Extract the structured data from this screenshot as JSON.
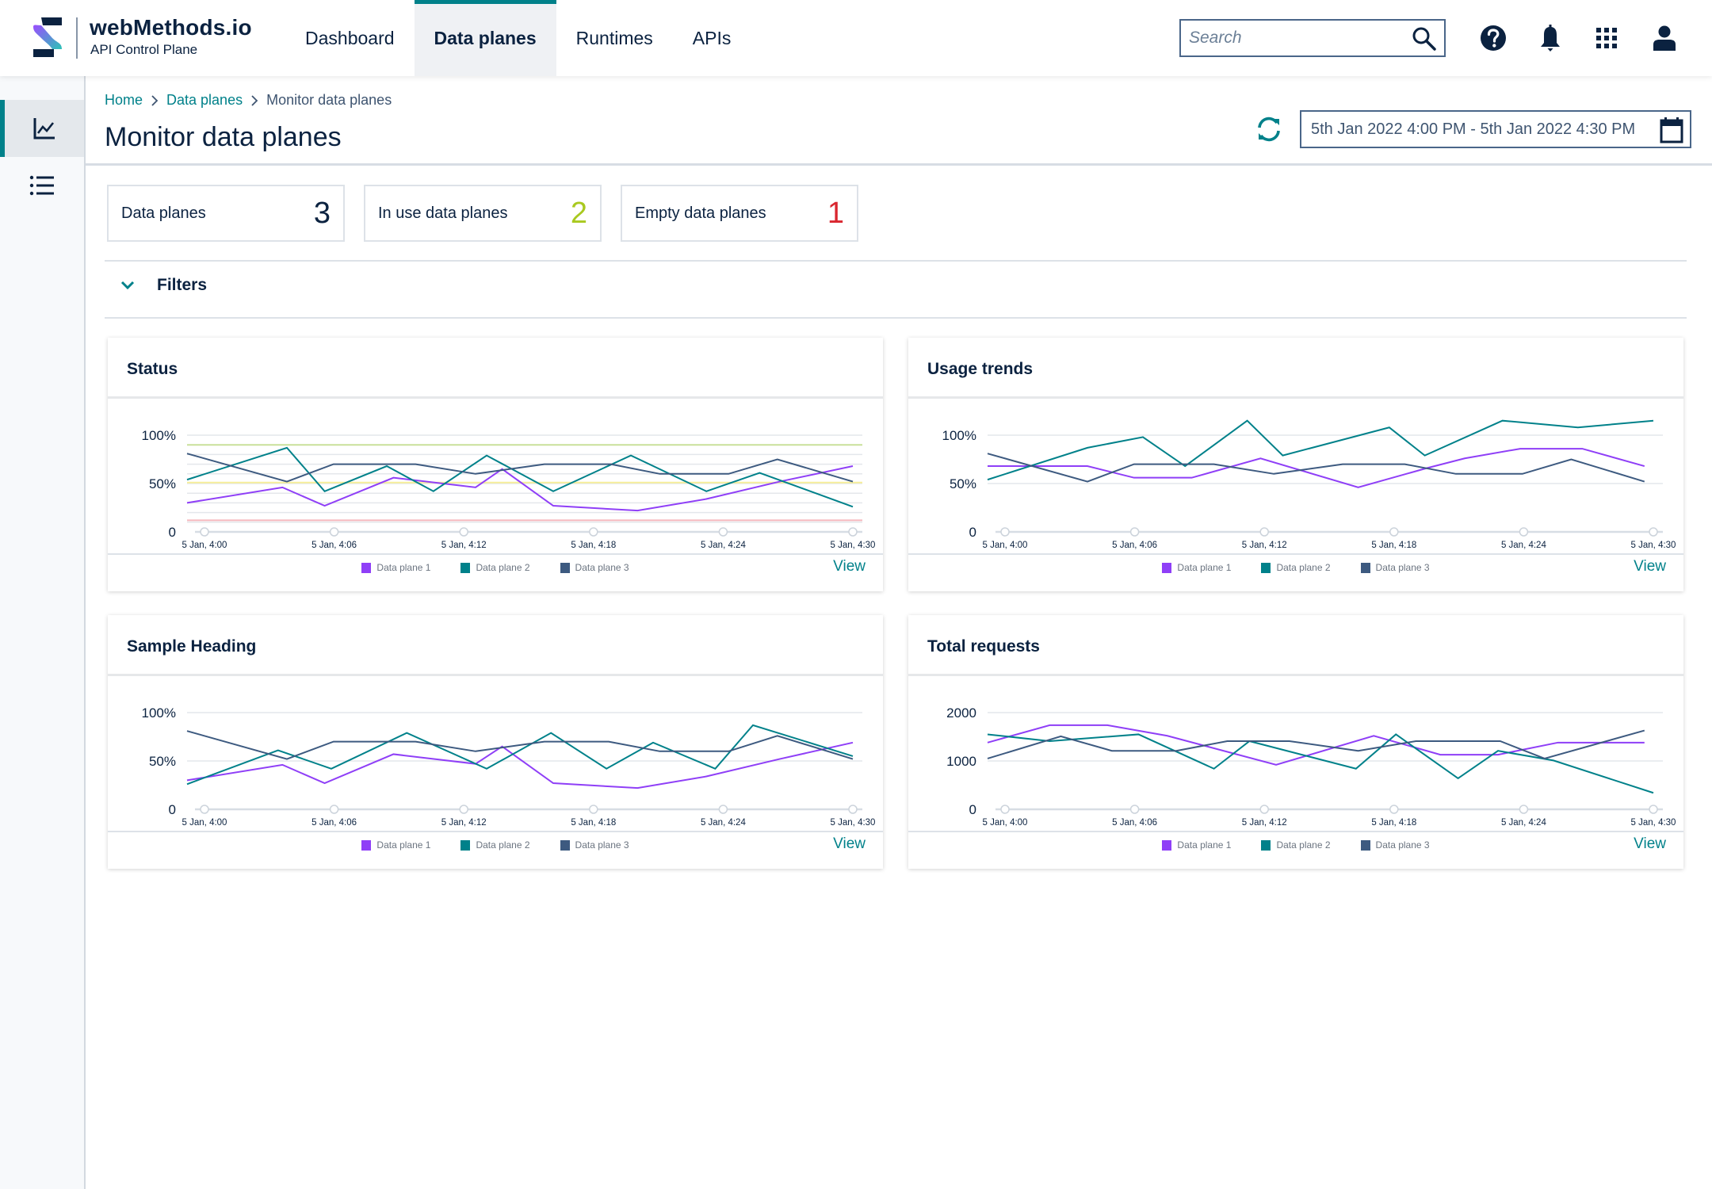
{
  "header": {
    "brand_title": "webMethods.io",
    "brand_subtitle": "API Control Plane",
    "nav_tabs": [
      {
        "label": "Dashboard",
        "active": false
      },
      {
        "label": "Data planes",
        "active": true
      },
      {
        "label": "Runtimes",
        "active": false
      },
      {
        "label": "APIs",
        "active": false
      }
    ],
    "search_placeholder": "Search",
    "search_value": "",
    "icons": [
      "search-icon",
      "help-icon",
      "bell-icon",
      "apps-grid-icon",
      "user-icon"
    ]
  },
  "sidebar": {
    "items": [
      {
        "icon": "line-chart-icon",
        "active": true
      },
      {
        "icon": "list-icon",
        "active": false
      }
    ]
  },
  "breadcrumb": [
    {
      "label": "Home",
      "link": true
    },
    {
      "label": "Data planes",
      "link": true
    },
    {
      "label": "Monitor data planes",
      "link": false
    }
  ],
  "page": {
    "title": "Monitor data planes",
    "date_range": "5th Jan 2022 4:00 PM - 5th Jan 2022 4:30 PM"
  },
  "stats": [
    {
      "label": "Data planes",
      "value": "3",
      "color": "#0b2240"
    },
    {
      "label": "In use data planes",
      "value": "2",
      "color": "#a9c91f"
    },
    {
      "label": "Empty data planes",
      "value": "1",
      "color": "#d9262f"
    }
  ],
  "filters": {
    "label": "Filters",
    "expanded": false
  },
  "colors": {
    "accent": "#00818a",
    "series": [
      "#8f3ff7",
      "#00818a",
      "#3d5a80"
    ],
    "threshold_green": "#c9e09a",
    "threshold_yellow": "#f7ef9a",
    "threshold_red": "#f5b8bd"
  },
  "view_label": "View",
  "chart_data": [
    {
      "type": "line",
      "title": "Status",
      "xlabel": "",
      "ylabel": "",
      "x_unit": "minutes after 5 Jan, 4:00",
      "xlim": [
        0,
        30
      ],
      "ylim": [
        0,
        100
      ],
      "yticks": [
        0,
        50,
        100
      ],
      "ytick_labels": [
        "0",
        "50%",
        "100%"
      ],
      "xtick_labels": [
        "5 Jan, 4:00",
        "5 Jan, 4:06",
        "5 Jan, 4:12",
        "5 Jan, 4:18",
        "5 Jan, 4:24",
        "5 Jan, 4:30"
      ],
      "grid": true,
      "thresholds": [
        {
          "value": 90,
          "color": "green"
        },
        {
          "value": 51,
          "color": "yellow"
        },
        {
          "value": 12,
          "color": "red"
        }
      ],
      "legend": "bottom-center",
      "series": [
        {
          "name": "Data plane 1",
          "x": [
            0,
            4.3,
            6.2,
            9.3,
            13,
            14.2,
            16.5,
            20.3,
            23.4,
            26.7,
            30
          ],
          "values": [
            30,
            46,
            27,
            56,
            46,
            65,
            27,
            22,
            34,
            52,
            68
          ]
        },
        {
          "name": "Data plane 2",
          "x": [
            0,
            4.5,
            6.2,
            9,
            11.1,
            13.5,
            16.5,
            20,
            23.4,
            25.8,
            30
          ],
          "values": [
            54,
            87,
            42,
            68,
            42,
            79,
            42,
            79,
            42,
            61,
            26
          ]
        },
        {
          "name": "Data plane 3",
          "x": [
            0,
            4.5,
            6.6,
            10.3,
            13,
            16.1,
            19.1,
            21.3,
            24.4,
            26.6,
            30
          ],
          "values": [
            81,
            52,
            70,
            70,
            60,
            70,
            70,
            60,
            60,
            75,
            52
          ]
        }
      ]
    },
    {
      "type": "line",
      "title": "Usage trends",
      "xlabel": "",
      "ylabel": "",
      "x_unit": "minutes after 5 Jan, 4:00",
      "xlim": [
        0,
        30
      ],
      "ylim": [
        0,
        100
      ],
      "yticks": [
        0,
        50,
        100
      ],
      "ytick_labels": [
        "0",
        "50%",
        "100%"
      ],
      "xtick_labels": [
        "5 Jan, 4:00",
        "5 Jan, 4:06",
        "5 Jan, 4:12",
        "5 Jan, 4:18",
        "5 Jan, 4:24",
        "5 Jan, 4:30"
      ],
      "grid": true,
      "legend": "bottom-center",
      "series": [
        {
          "name": "Data plane 1",
          "x": [
            0,
            4.5,
            6.6,
            9.2,
            12.3,
            16.7,
            19.8,
            21.5,
            24,
            26.8,
            29.6
          ],
          "values": [
            68,
            68,
            56,
            56,
            76,
            46,
            66,
            76,
            86,
            86,
            68
          ]
        },
        {
          "name": "Data plane 2",
          "x": [
            0,
            4.5,
            7,
            8.9,
            11.7,
            13.3,
            18.1,
            19.7,
            23.2,
            26.6,
            30
          ],
          "values": [
            54,
            87,
            98,
            68,
            115,
            79,
            108,
            79,
            115,
            108,
            115
          ]
        },
        {
          "name": "Data plane 3",
          "x": [
            0,
            4.5,
            6.6,
            10.2,
            12.9,
            16,
            18.8,
            21.1,
            24.1,
            26.3,
            29.6
          ],
          "values": [
            81,
            52,
            70,
            70,
            60,
            70,
            70,
            60,
            60,
            75,
            52
          ]
        }
      ]
    },
    {
      "type": "line",
      "title": "Sample Heading",
      "xlabel": "",
      "ylabel": "",
      "x_unit": "minutes after 5 Jan, 4:00",
      "xlim": [
        0,
        30
      ],
      "ylim": [
        0,
        100
      ],
      "yticks": [
        0,
        50,
        100
      ],
      "ytick_labels": [
        "0",
        "50%",
        "100%"
      ],
      "xtick_labels": [
        "5 Jan, 4:00",
        "5 Jan, 4:06",
        "5 Jan, 4:12",
        "5 Jan, 4:18",
        "5 Jan, 4:24",
        "5 Jan, 4:30"
      ],
      "grid": true,
      "legend": "bottom-center",
      "series": [
        {
          "name": "Data plane 1",
          "x": [
            0,
            4.3,
            6.2,
            9.3,
            13,
            14.2,
            16.5,
            20.3,
            23.4,
            26.7,
            30
          ],
          "values": [
            30,
            46,
            27,
            57,
            47,
            65,
            27,
            22,
            34,
            52,
            69
          ]
        },
        {
          "name": "Data plane 2",
          "x": [
            0,
            4.1,
            6.5,
            9.9,
            13.5,
            16.4,
            18.9,
            21,
            23.8,
            25.5,
            30
          ],
          "values": [
            26,
            61,
            42,
            79,
            42,
            79,
            42,
            69,
            42,
            87,
            55
          ]
        },
        {
          "name": "Data plane 3",
          "x": [
            0,
            4.5,
            6.6,
            10.3,
            13,
            16.1,
            19,
            21.3,
            24.4,
            26.6,
            30
          ],
          "values": [
            81,
            52,
            70,
            70,
            60,
            70,
            70,
            60,
            60,
            76,
            52
          ]
        }
      ]
    },
    {
      "type": "line",
      "title": "Total requests",
      "xlabel": "",
      "ylabel": "",
      "x_unit": "minutes after 5 Jan, 4:00",
      "xlim": [
        0,
        30
      ],
      "ylim": [
        0,
        2000
      ],
      "yticks": [
        0,
        1000,
        2000
      ],
      "ytick_labels": [
        "0",
        "1000",
        "2000"
      ],
      "xtick_labels": [
        "5 Jan, 4:00",
        "5 Jan, 4:06",
        "5 Jan, 4:12",
        "5 Jan, 4:18",
        "5 Jan, 4:24",
        "5 Jan, 4:30"
      ],
      "grid": true,
      "legend": "bottom-center",
      "series": [
        {
          "name": "Data plane 1",
          "x": [
            0,
            2.8,
            5.4,
            8.1,
            13,
            17.4,
            20.4,
            23,
            25.7,
            29.6
          ],
          "values": [
            1380,
            1740,
            1740,
            1520,
            920,
            1520,
            1130,
            1130,
            1380,
            1380
          ]
        },
        {
          "name": "Data plane 2",
          "x": [
            0,
            2.8,
            6.8,
            10.2,
            11.8,
            16.6,
            18.4,
            21.2,
            23,
            25.5,
            30
          ],
          "values": [
            1550,
            1410,
            1550,
            840,
            1410,
            840,
            1550,
            640,
            1210,
            1010,
            340
          ]
        },
        {
          "name": "Data plane 3",
          "x": [
            0,
            3.3,
            5.6,
            8.5,
            10.8,
            13.6,
            16.7,
            19.3,
            23.1,
            25.1,
            29.6
          ],
          "values": [
            1050,
            1510,
            1210,
            1210,
            1410,
            1410,
            1210,
            1410,
            1410,
            1050,
            1630
          ]
        }
      ]
    }
  ]
}
